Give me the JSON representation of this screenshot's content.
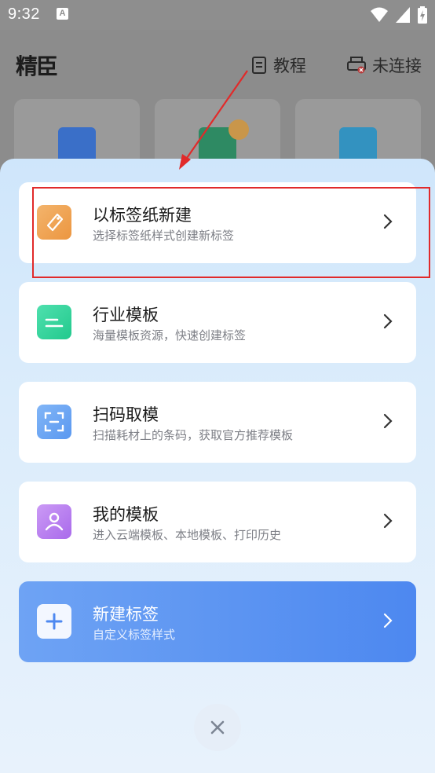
{
  "status_bar": {
    "time": "9:32",
    "notification_icon_letter": "A",
    "icons": [
      "wifi-icon",
      "signal-icon",
      "battery-charging-icon"
    ]
  },
  "header": {
    "logo_text": "精臣",
    "tutorial_label": "教程",
    "connect_label": "未连接"
  },
  "background_tiles": [
    {
      "icon": "pdf-icon",
      "color": "#3a6fc8"
    },
    {
      "icon": "scan-icon",
      "color": "#2e8a63"
    },
    {
      "icon": "folder-icon",
      "color": "#3392c0"
    }
  ],
  "sheet": {
    "items": [
      {
        "title": "以标签纸新建",
        "subtitle": "选择标签纸样式创建新标签",
        "icon": "tag-icon",
        "color": "#f0a55a"
      },
      {
        "title": "行业模板",
        "subtitle": "海量模板资源，快速创建标签",
        "icon": "template-icon",
        "color": "#2ed29b"
      },
      {
        "title": "扫码取模",
        "subtitle": "扫描耗材上的条码，获取官方推荐模板",
        "icon": "scan-code-icon",
        "color": "#5f9df3"
      },
      {
        "title": "我的模板",
        "subtitle": "进入云端模板、本地模板、打印历史",
        "icon": "user-template-icon",
        "color": "#b77ff0"
      },
      {
        "title": "新建标签",
        "subtitle": "自定义标签样式",
        "icon": "plus-icon",
        "color": "#ffffff"
      }
    ],
    "close_icon": "close-icon"
  },
  "annotation": {
    "color": "#e12a2a",
    "target": "以标签纸新建"
  }
}
